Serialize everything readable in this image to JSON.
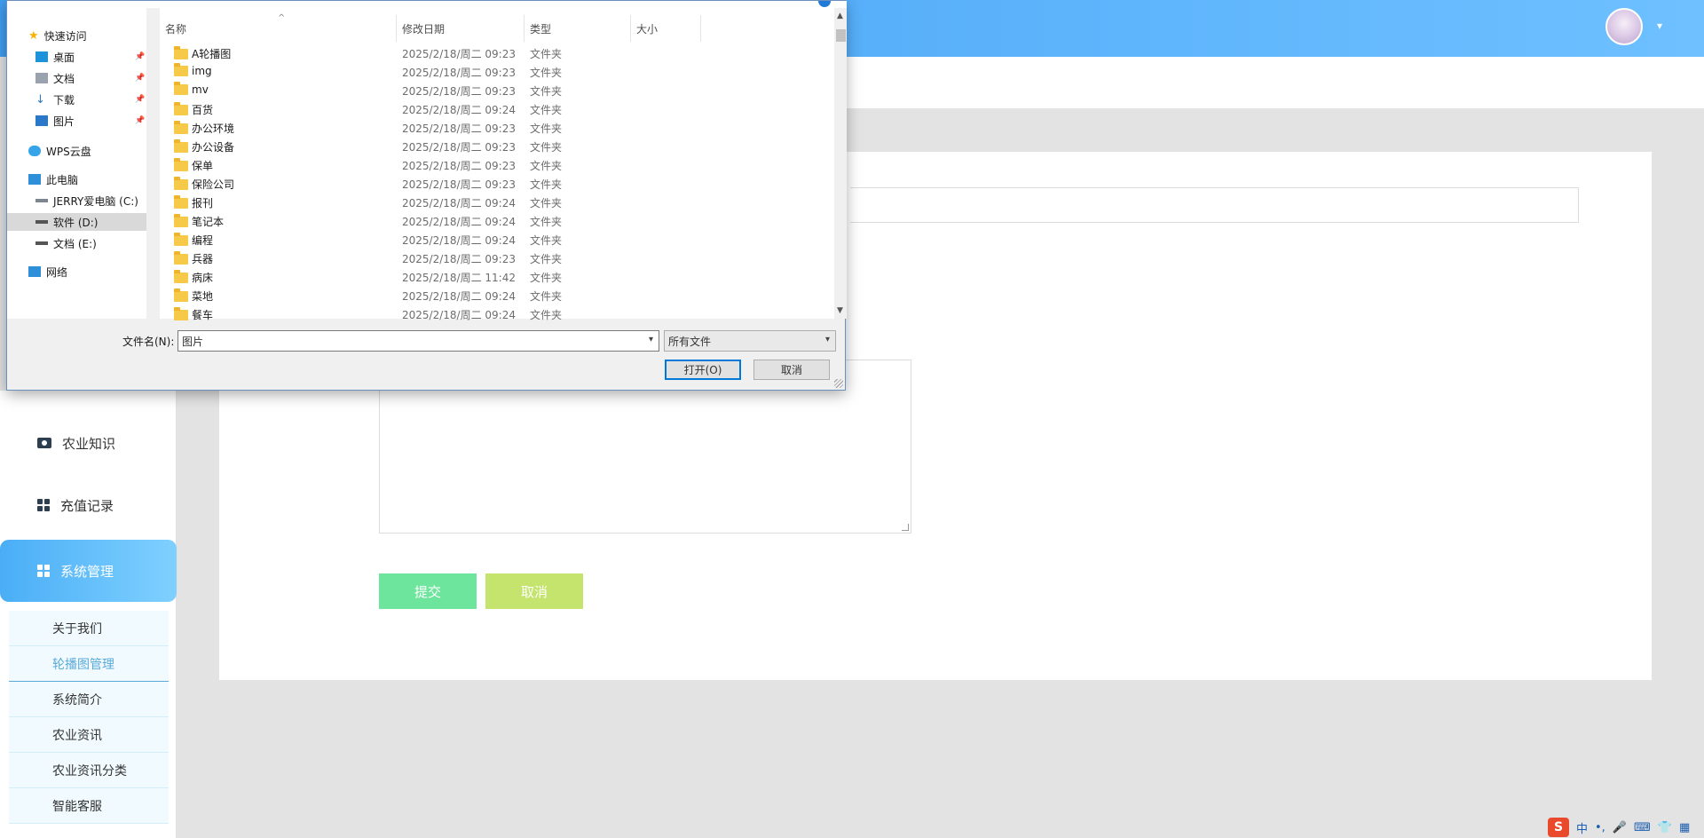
{
  "sidebar": {
    "items": [
      {
        "label": "农业知识",
        "icon": "flag-icon"
      },
      {
        "label": "充值记录",
        "icon": "grid-icon"
      },
      {
        "label": "系统管理",
        "icon": "grid-icon",
        "active": true
      }
    ],
    "submenu": [
      {
        "label": "关于我们"
      },
      {
        "label": "轮播图管理",
        "active": true
      },
      {
        "label": "系统简介"
      },
      {
        "label": "农业资讯"
      },
      {
        "label": "农业资讯分类"
      },
      {
        "label": "智能客服"
      }
    ]
  },
  "form": {
    "submit_label": "提交",
    "cancel_label": "取消"
  },
  "tray": {
    "ime_label": "S",
    "lang": "中",
    "punct": "•,"
  },
  "dialog": {
    "nav": {
      "quick_access": "快速访问",
      "desktop": "桌面",
      "documents": "文档",
      "downloads": "下载",
      "pictures": "图片",
      "wps": "WPS云盘",
      "this_pc": "此电脑",
      "drive_c": "JERRY爱电脑 (C:)",
      "drive_d": "软件 (D:)",
      "drive_e": "文档 (E:)",
      "network": "网络"
    },
    "columns": {
      "name": "名称",
      "modified": "修改日期",
      "type": "类型",
      "size": "大小"
    },
    "files": [
      {
        "name": "A轮播图",
        "date": "2025/2/18/周二 09:23",
        "type": "文件夹"
      },
      {
        "name": "img",
        "date": "2025/2/18/周二 09:23",
        "type": "文件夹"
      },
      {
        "name": "mv",
        "date": "2025/2/18/周二 09:23",
        "type": "文件夹"
      },
      {
        "name": "百货",
        "date": "2025/2/18/周二 09:24",
        "type": "文件夹"
      },
      {
        "name": "办公环境",
        "date": "2025/2/18/周二 09:23",
        "type": "文件夹"
      },
      {
        "name": "办公设备",
        "date": "2025/2/18/周二 09:23",
        "type": "文件夹"
      },
      {
        "name": "保单",
        "date": "2025/2/18/周二 09:23",
        "type": "文件夹"
      },
      {
        "name": "保险公司",
        "date": "2025/2/18/周二 09:23",
        "type": "文件夹"
      },
      {
        "name": "报刊",
        "date": "2025/2/18/周二 09:24",
        "type": "文件夹"
      },
      {
        "name": "笔记本",
        "date": "2025/2/18/周二 09:24",
        "type": "文件夹"
      },
      {
        "name": "编程",
        "date": "2025/2/18/周二 09:24",
        "type": "文件夹"
      },
      {
        "name": "兵器",
        "date": "2025/2/18/周二 09:23",
        "type": "文件夹"
      },
      {
        "name": "病床",
        "date": "2025/2/18/周二 11:42",
        "type": "文件夹"
      },
      {
        "name": "菜地",
        "date": "2025/2/18/周二 09:24",
        "type": "文件夹"
      },
      {
        "name": "餐车",
        "date": "2025/2/18/周二 09:24",
        "type": "文件夹"
      }
    ],
    "filename_label": "文件名(N):",
    "filename_value": "图片",
    "filter_value": "所有文件",
    "open_label": "打开(O)",
    "cancel_label": "取消"
  }
}
